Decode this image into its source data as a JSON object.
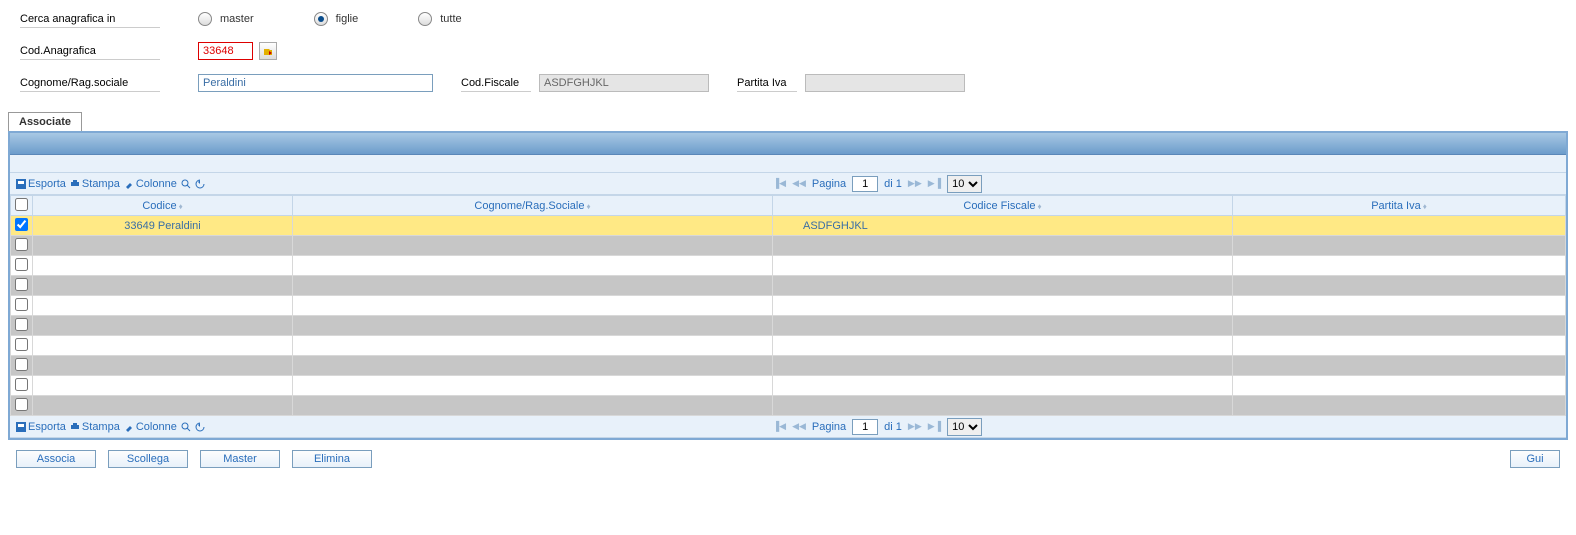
{
  "search": {
    "label": "Cerca anagrafica in",
    "options": {
      "master": "master",
      "figlie": "figlie",
      "tutte": "tutte"
    },
    "selected": "figlie"
  },
  "form": {
    "cod_label": "Cod.Anagrafica",
    "cod_value": "33648",
    "cognome_label": "Cognome/Rag.sociale",
    "cognome_value": "Peraldini",
    "codfisc_label": "Cod.Fiscale",
    "codfisc_value": "ASDFGHJKL",
    "piva_label": "Partita Iva",
    "piva_value": ""
  },
  "tab": {
    "associate": "Associate"
  },
  "toolbar": {
    "esporta": "Esporta",
    "stampa": "Stampa",
    "colonne": "Colonne"
  },
  "pager": {
    "pagina_label": "Pagina",
    "page_value": "1",
    "di_label": "di 1",
    "size": "10"
  },
  "columns": {
    "codice": "Codice",
    "cognome": "Cognome/Rag.Sociale",
    "codfisc": "Codice Fiscale",
    "piva": "Partita Iva"
  },
  "rows": [
    {
      "checked": true,
      "codice": "33649 Peraldini",
      "cognome": "",
      "codfisc": "ASDFGHJKL",
      "piva": ""
    }
  ],
  "empty_rows": 9,
  "buttons": {
    "associa": "Associa",
    "scollega": "Scollega",
    "master": "Master",
    "elimina": "Elimina",
    "guida": "Gui"
  }
}
